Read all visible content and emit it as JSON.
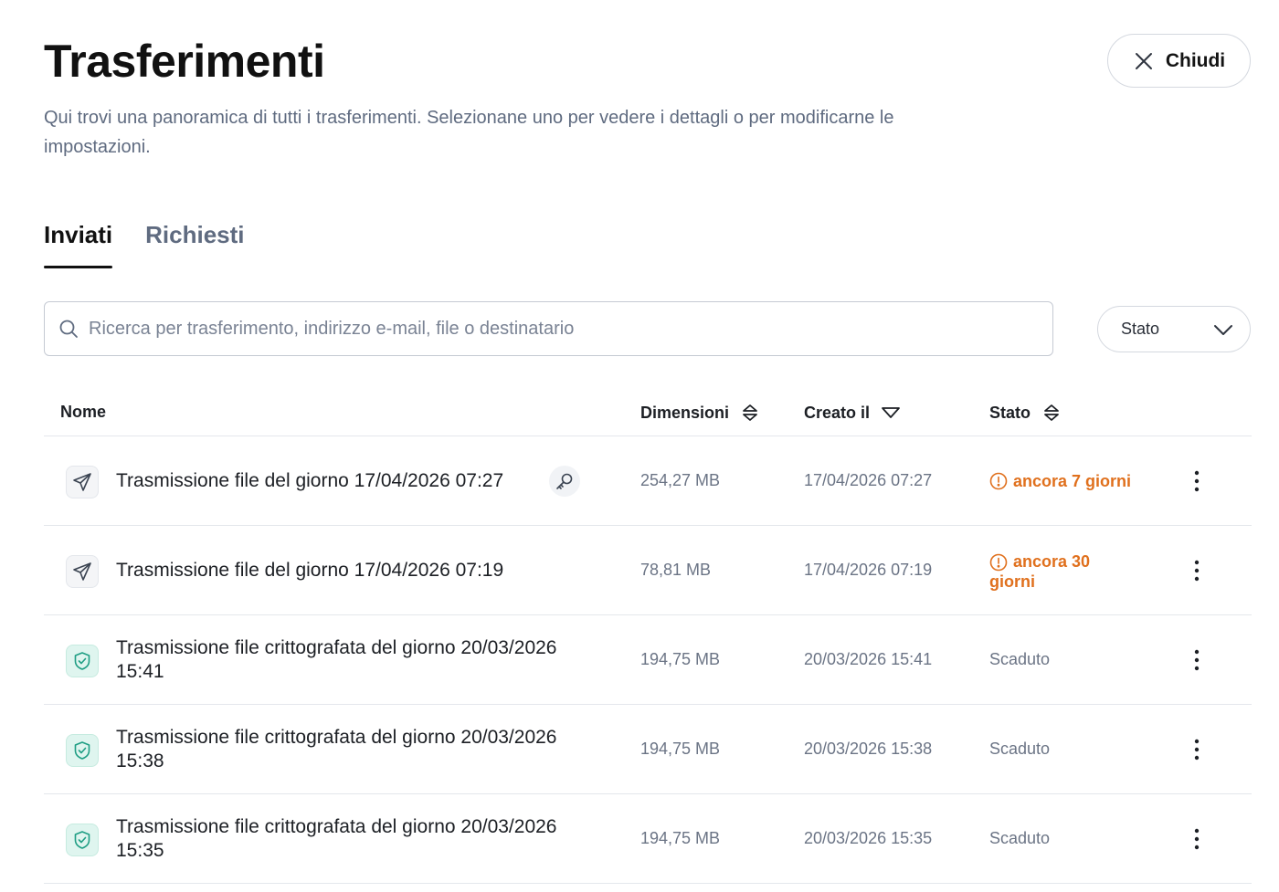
{
  "header": {
    "title": "Trasferimenti",
    "description": "Qui trovi una panoramica di tutti i trasferimenti. Selezionane uno per vedere i dettagli o per modificarne le impostazioni.",
    "close_label": "Chiudi"
  },
  "tabs": [
    {
      "label": "Inviati",
      "active": true
    },
    {
      "label": "Richiesti",
      "active": false
    }
  ],
  "search": {
    "placeholder": "Ricerca per trasferimento, indirizzo e-mail, file o destinatario",
    "value": ""
  },
  "status_filter": {
    "label": "Stato"
  },
  "table": {
    "columns": {
      "name": "Nome",
      "size": "Dimensioni",
      "created": "Creato il",
      "status": "Stato"
    },
    "rows": [
      {
        "icon": "paper-plane-icon",
        "name": "Trasmissione file del giorno 17/04/2026 07:27",
        "has_key": true,
        "size": "254,27 MB",
        "created": "17/04/2026 07:27",
        "status": "ancora 7 giorni",
        "status_type": "warning"
      },
      {
        "icon": "paper-plane-icon",
        "name": "Trasmissione file del giorno 17/04/2026 07:19",
        "has_key": false,
        "size": "78,81 MB",
        "created": "17/04/2026 07:19",
        "status": "ancora 30 giorni",
        "status_type": "warning"
      },
      {
        "icon": "shield-check-icon",
        "name": "Trasmissione file crittografata del giorno 20/03/2026 15:41",
        "has_key": false,
        "size": "194,75 MB",
        "created": "20/03/2026 15:41",
        "status": "Scaduto",
        "status_type": "expired"
      },
      {
        "icon": "shield-check-icon",
        "name": "Trasmissione file crittografata del giorno 20/03/2026 15:38",
        "has_key": false,
        "size": "194,75 MB",
        "created": "20/03/2026 15:38",
        "status": "Scaduto",
        "status_type": "expired"
      },
      {
        "icon": "shield-check-icon",
        "name": "Trasmissione file crittografata del giorno 20/03/2026 15:35",
        "has_key": false,
        "size": "194,75 MB",
        "created": "20/03/2026 15:35",
        "status": "Scaduto",
        "status_type": "expired"
      }
    ]
  },
  "colors": {
    "warning": "#e0701d",
    "secure_bg": "#dff5ef",
    "secure_icon": "#1f9e84",
    "muted_text": "#5f6b80"
  }
}
